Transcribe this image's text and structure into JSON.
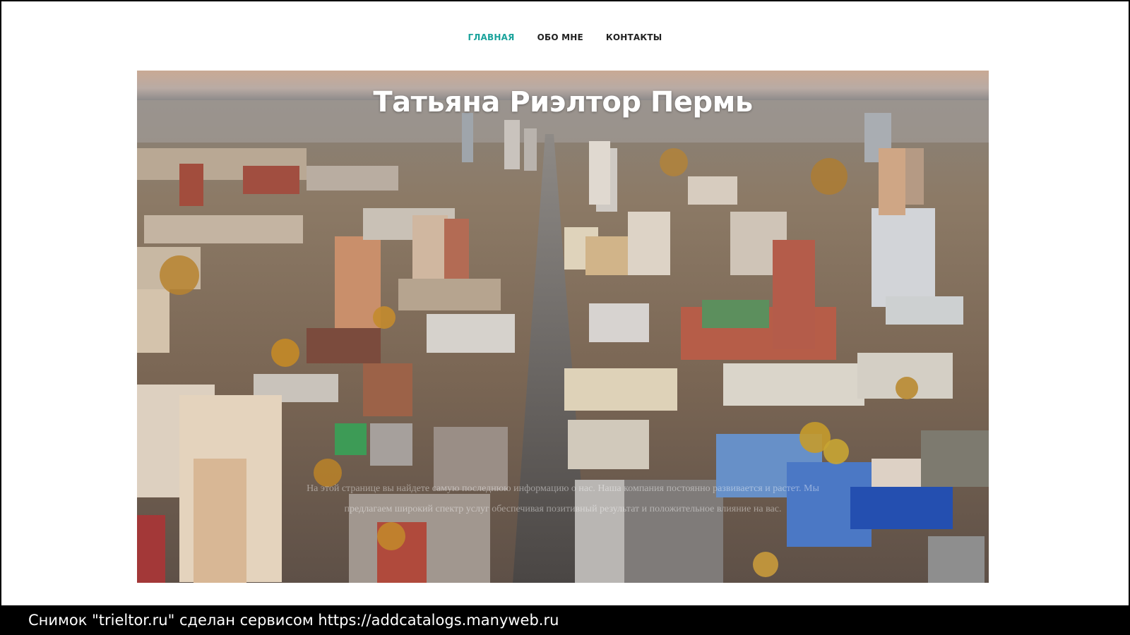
{
  "nav": {
    "items": [
      {
        "label": "ГЛАВНАЯ",
        "active": true
      },
      {
        "label": "ОБО МНЕ",
        "active": false
      },
      {
        "label": "КОНТАКТЫ",
        "active": false
      }
    ],
    "active_color": "#1ba39c"
  },
  "hero": {
    "title": "Татьяна Риэлтор Пермь",
    "paragraph": "На этой странице вы найдете самую последнюю информацию о нас. Наша компания постоянно развивается и растет. Мы предлагаем широкий спектр услуг обеспечивая позитивный результат и положительное влияние на вас.",
    "image_desc": "aerial-city-photo"
  },
  "footer": {
    "caption": "Снимок \"trieltor.ru\" сделан сервисом https://addcatalogs.manyweb.ru"
  }
}
